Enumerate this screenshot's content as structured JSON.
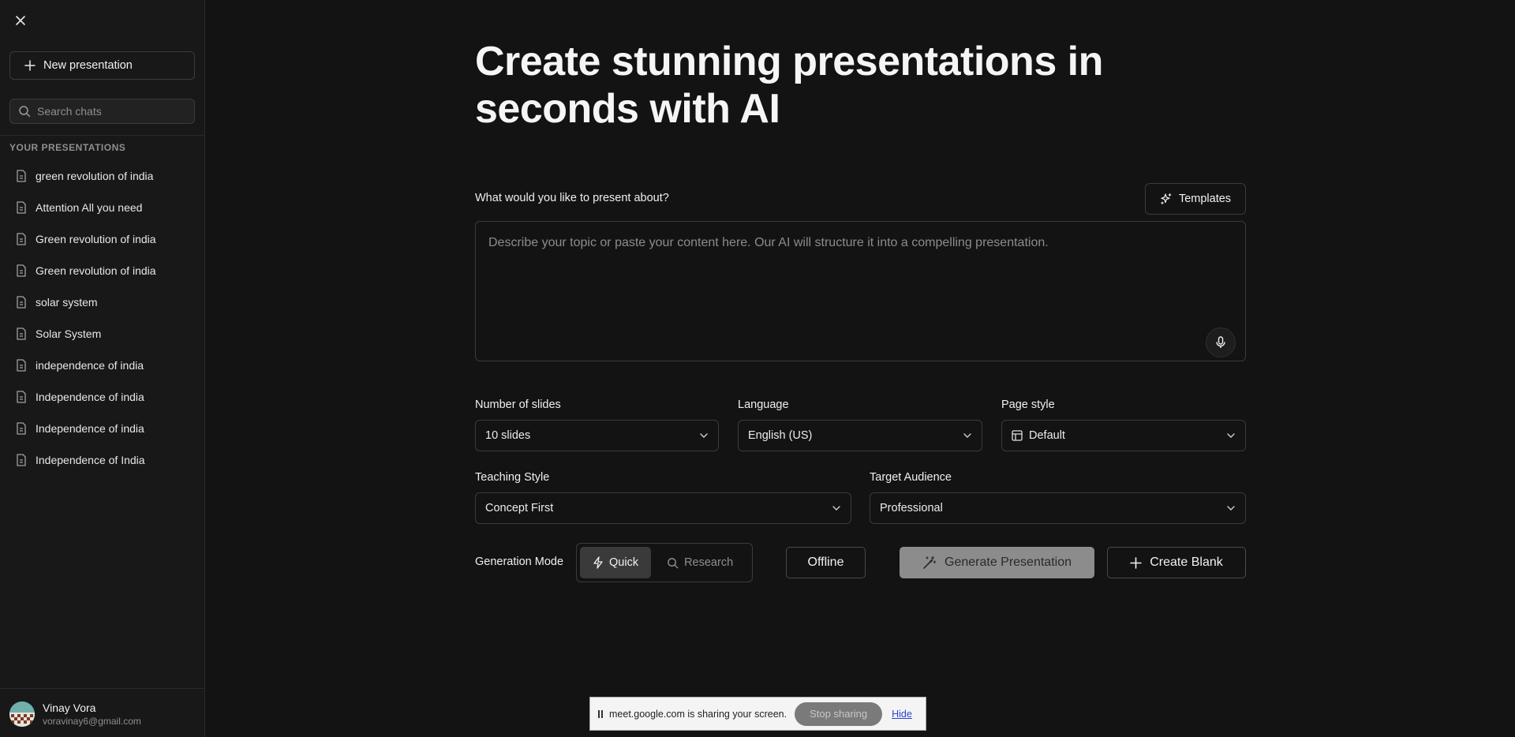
{
  "sidebar": {
    "new_presentation_label": "New presentation",
    "search_placeholder": "Search chats",
    "section_title": "YOUR PRESENTATIONS",
    "items": [
      {
        "label": "green revolution of india"
      },
      {
        "label": "Attention All you need"
      },
      {
        "label": "Green revolution of india"
      },
      {
        "label": "Green revolution of india"
      },
      {
        "label": "solar system"
      },
      {
        "label": "Solar System"
      },
      {
        "label": "independence of india"
      },
      {
        "label": "Independence of india"
      },
      {
        "label": "Independence of india"
      },
      {
        "label": "Independence of India"
      }
    ],
    "user": {
      "name": "Vinay Vora",
      "email": "voravinay6@gmail.com"
    }
  },
  "main": {
    "headline": "Create stunning presentations in seconds with AI",
    "prompt_label": "What would you like to present about?",
    "templates_label": "Templates",
    "prompt_placeholder": "Describe your topic or paste your content here. Our AI will structure it into a compelling presentation.",
    "slides": {
      "label": "Number of slides",
      "value": "10 slides"
    },
    "language": {
      "label": "Language",
      "value": "English (US)"
    },
    "page_style": {
      "label": "Page style",
      "value": "Default"
    },
    "teaching_style": {
      "label": "Teaching Style",
      "value": "Concept First"
    },
    "target_audience": {
      "label": "Target Audience",
      "value": "Professional"
    },
    "generation_mode": {
      "label": "Generation Mode",
      "quick_label": "Quick",
      "research_label": "Research",
      "selected": "Quick"
    },
    "offline_label": "Offline",
    "generate_label": "Generate Presentation",
    "create_blank_label": "Create Blank"
  },
  "share_bar": {
    "message": "meet.google.com is sharing your screen.",
    "stop_label": "Stop sharing",
    "hide_label": "Hide"
  },
  "colors": {
    "background": "#131313",
    "sidebar": "#181818",
    "border": "#3b3b3b",
    "generate_button": "#8c8c8c"
  }
}
